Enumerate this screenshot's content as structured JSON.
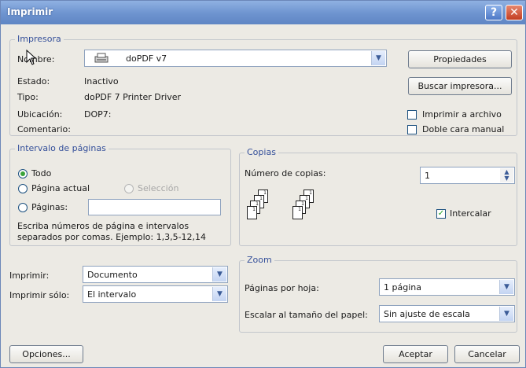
{
  "window": {
    "title": "Imprimir",
    "help_glyph": "?",
    "close_glyph": "✕"
  },
  "printer": {
    "legend": "Impresora",
    "name_label": "Nombre:",
    "name_value": "doPDF v7",
    "state_label": "Estado:",
    "state_value": "Inactivo",
    "type_label": "Tipo:",
    "type_value": "doPDF 7 Printer Driver",
    "location_label": "Ubicación:",
    "location_value": "DOP7:",
    "comment_label": "Comentario:",
    "properties_button": "Propiedades",
    "find_button": "Buscar impresora...",
    "print_to_file_label": "Imprimir a archivo",
    "print_to_file_checked": false,
    "duplex_label": "Doble cara manual",
    "duplex_checked": false
  },
  "range": {
    "legend": "Intervalo de páginas",
    "all_label": "Todo",
    "current_label": "Página actual",
    "selection_label": "Selección",
    "pages_label": "Páginas:",
    "pages_value": "",
    "help_text_line1": "Escriba números de página e intervalos",
    "help_text_line2": "separados por comas. Ejemplo: 1,3,5-12,14",
    "selected": "all"
  },
  "copies": {
    "legend": "Copias",
    "count_label": "Número de copias:",
    "count_value": "1",
    "collate_label": "Intercalar",
    "collate_checked": true
  },
  "print_what": {
    "label": "Imprimir:",
    "value": "Documento"
  },
  "print_only": {
    "label": "Imprimir sólo:",
    "value": "El intervalo"
  },
  "zoom": {
    "legend": "Zoom",
    "pages_per_sheet_label": "Páginas por hoja:",
    "pages_per_sheet_value": "1 página",
    "scale_label": "Escalar al tamaño del papel:",
    "scale_value": "Sin ajuste de escala"
  },
  "footer": {
    "options_button": "Opciones...",
    "ok_button": "Aceptar",
    "cancel_button": "Cancelar"
  }
}
